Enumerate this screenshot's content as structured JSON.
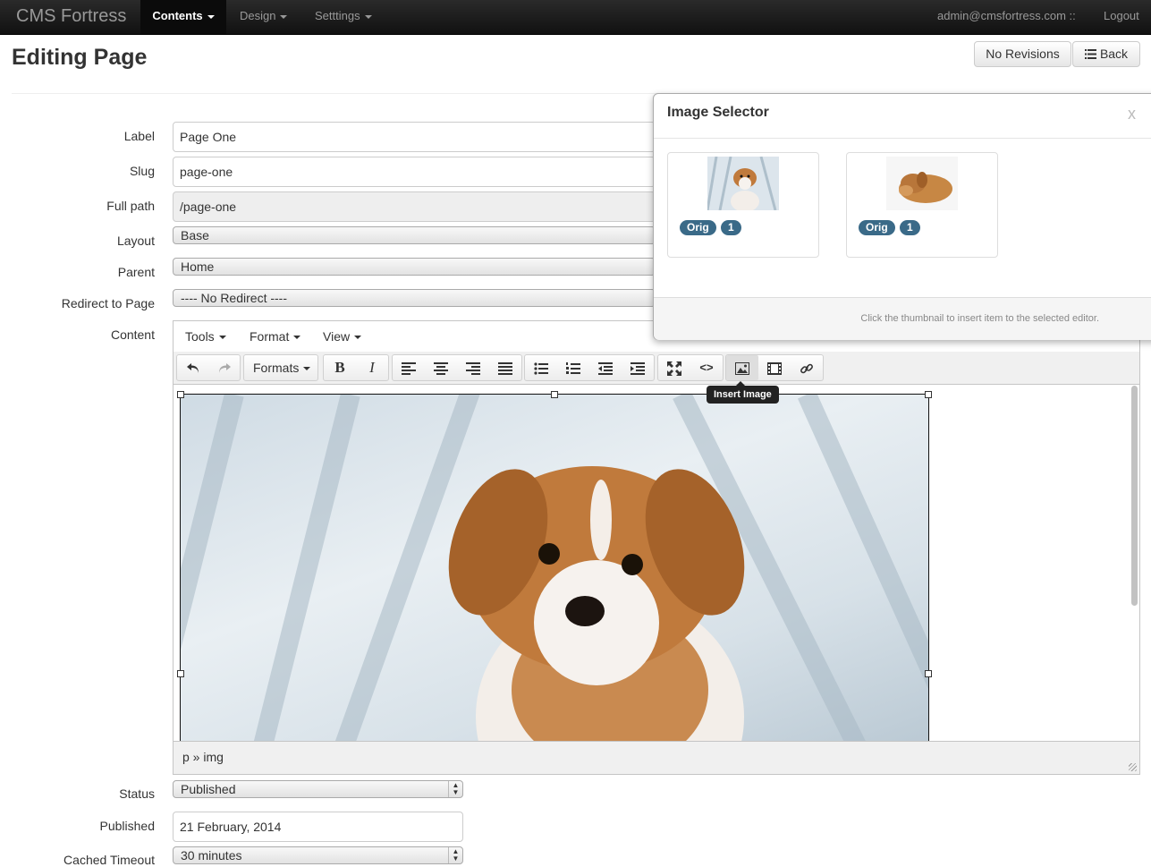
{
  "nav": {
    "brand": "CMS Fortress",
    "items": [
      {
        "label": "Contents"
      },
      {
        "label": "Design"
      },
      {
        "label": "Setttings"
      }
    ],
    "user": "admin@cmsfortress.com ::",
    "logout": "Logout"
  },
  "header": {
    "title": "Editing Page",
    "no_revisions": "No Revisions",
    "back": "Back"
  },
  "form": {
    "label": {
      "label": "Label",
      "value": "Page One"
    },
    "slug": {
      "label": "Slug",
      "value": "page-one"
    },
    "full_path": {
      "label": "Full path",
      "value": "/page-one"
    },
    "layout": {
      "label": "Layout",
      "value": "Base"
    },
    "parent": {
      "label": "Parent",
      "value": "Home"
    },
    "redirect": {
      "label": "Redirect to Page",
      "value": "---- No Redirect ----"
    },
    "content": {
      "label": "Content"
    },
    "status": {
      "label": "Status",
      "value": "Published"
    },
    "published": {
      "label": "Published",
      "value": "21 February, 2014"
    },
    "cached_timeout": {
      "label": "Cached Timeout",
      "value": "30 minutes"
    }
  },
  "editor": {
    "menus": [
      "Tools",
      "Format",
      "View"
    ],
    "formats_label": "Formats",
    "path": "p » img",
    "tooltip": "Insert Image"
  },
  "image_selector": {
    "title": "Image Selector",
    "close": "x",
    "images": [
      {
        "orig": "Orig",
        "count": "1"
      },
      {
        "orig": "Orig",
        "count": "1"
      }
    ],
    "footer": "Click the thumbnail to insert item to the selected editor."
  },
  "colors": {
    "navbar": "#1b1b1b",
    "badge": "#3a6a88"
  }
}
